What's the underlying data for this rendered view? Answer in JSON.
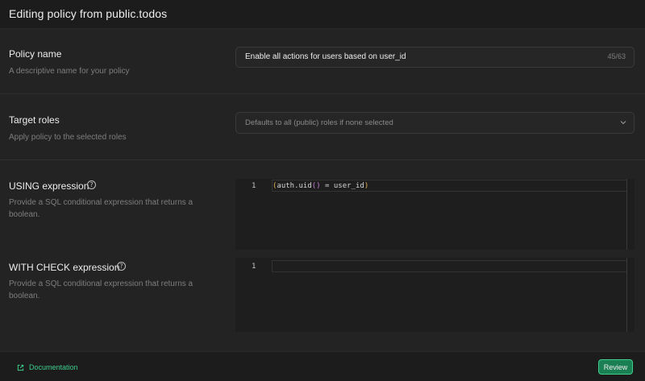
{
  "header": {
    "title": "Editing policy from public.todos"
  },
  "policy_name": {
    "label": "Policy name",
    "description": "A descriptive name for your policy",
    "value": "Enable all actions for users based on user_id",
    "counter": "45/63"
  },
  "target_roles": {
    "label": "Target roles",
    "description": "Apply policy to the selected roles",
    "placeholder": "Defaults to all (public) roles if none selected"
  },
  "using_expression": {
    "label": "USING expression",
    "description": "Provide a SQL conditional expression that returns a boolean.",
    "line_number": "1",
    "code_prefix": "auth.uid",
    "code_suffix": " = user_id"
  },
  "with_check_expression": {
    "label": "WITH CHECK expression",
    "description": "Provide a SQL conditional expression that returns a boolean.",
    "line_number": "1",
    "code": ""
  },
  "footer": {
    "documentation_label": "Documentation",
    "review_label": "Review"
  },
  "colors": {
    "accent": "#3ecf8e",
    "button_bg": "#1a7f52"
  }
}
